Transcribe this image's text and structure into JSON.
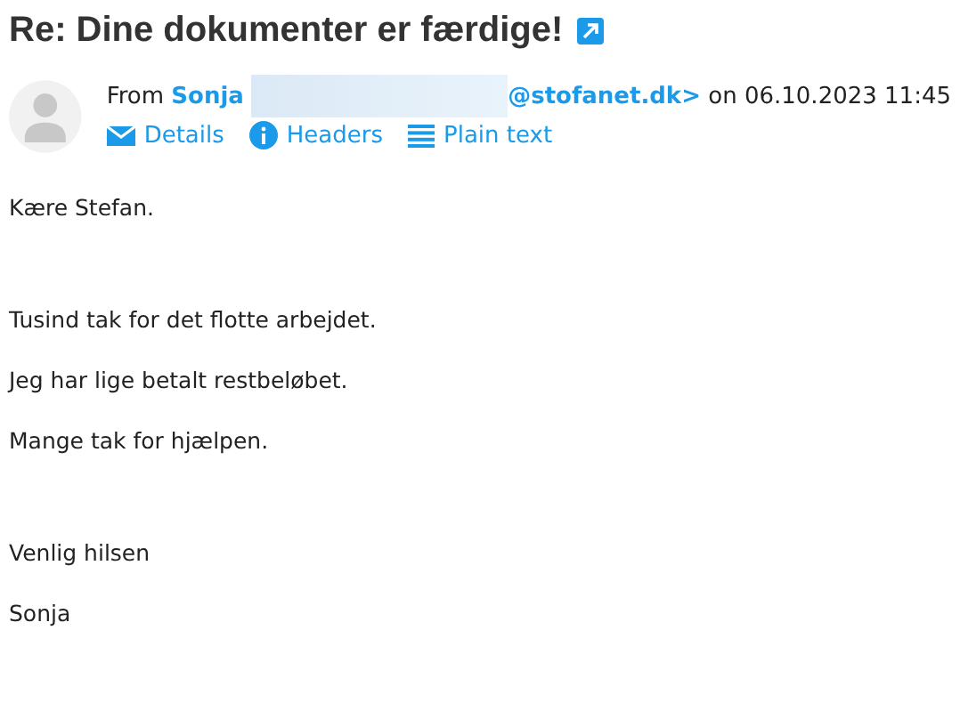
{
  "subject": "Re: Dine dokumenter er færdige!",
  "header": {
    "from_label": "From",
    "sender_name": "Sonja",
    "sender_email_end": "@stofanet.dk>",
    "date_prefix": "on",
    "date": "06.10.2023 11:45"
  },
  "actions": [
    {
      "kind": "mail",
      "label": "Details"
    },
    {
      "kind": "info",
      "label": "Headers"
    },
    {
      "kind": "lines",
      "label": "Plain text"
    }
  ],
  "body": [
    [
      "Kære Stefan."
    ],
    [
      "Tusind tak for det flotte arbejdet.",
      "Jeg har lige betalt restbeløbet.",
      "Mange tak for hjælpen."
    ],
    [
      "Venlig hilsen",
      "Sonja"
    ]
  ]
}
